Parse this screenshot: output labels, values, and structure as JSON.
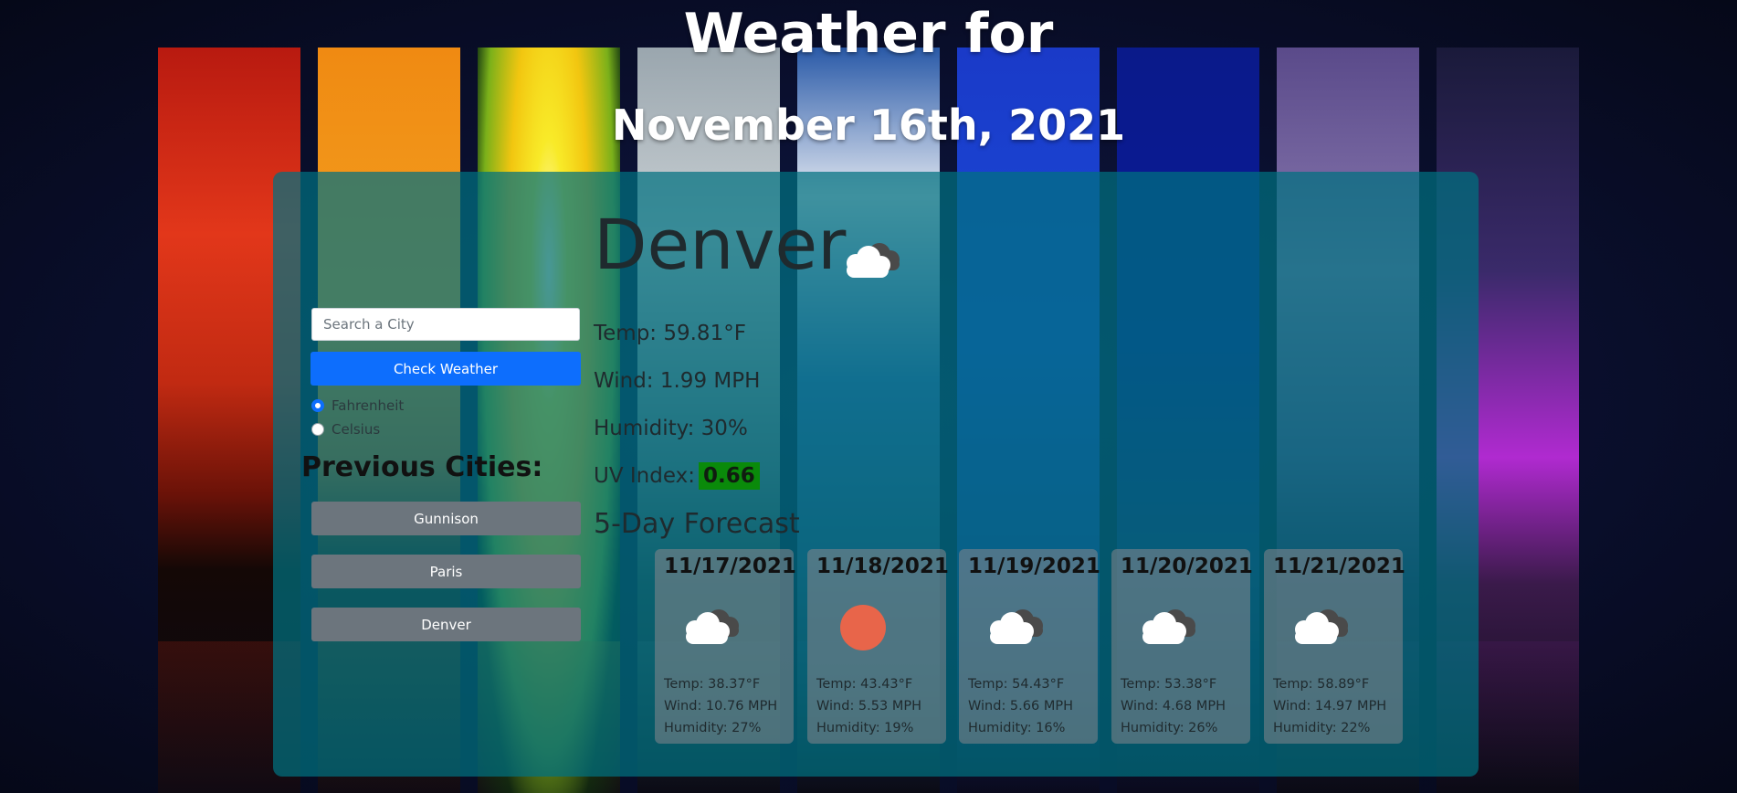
{
  "header": {
    "title_line1": "Weather for",
    "title_line2": "November 16th, 2021"
  },
  "search": {
    "placeholder": "Search a City",
    "value": "",
    "button_label": "Check Weather"
  },
  "units": {
    "options": [
      {
        "label": "Fahrenheit",
        "checked": true
      },
      {
        "label": "Celsius",
        "checked": false
      }
    ]
  },
  "history": {
    "title": "Previous Cities:",
    "cities": [
      "Gunnison",
      "Paris",
      "Denver"
    ]
  },
  "current": {
    "city": "Denver",
    "icon": "cloud-icon",
    "temp": "Temp: 59.81°F",
    "wind": "Wind: 1.99 MPH",
    "humidity": "Humidity: 30%",
    "uv_label": "UV Index:",
    "uv_value": "0.66",
    "uv_color": "#0a8a0a"
  },
  "forecast": {
    "title": "5-Day Forecast",
    "days": [
      {
        "date": "11/17/2021",
        "icon": "cloud-icon",
        "temp": "Temp: 38.37°F",
        "wind": "Wind: 10.76 MPH",
        "humidity": "Humidity: 27%"
      },
      {
        "date": "11/18/2021",
        "icon": "sun-icon",
        "temp": "Temp: 43.43°F",
        "wind": "Wind: 5.53 MPH",
        "humidity": "Humidity: 19%"
      },
      {
        "date": "11/19/2021",
        "icon": "cloud-icon",
        "temp": "Temp: 54.43°F",
        "wind": "Wind: 5.66 MPH",
        "humidity": "Humidity: 16%"
      },
      {
        "date": "11/20/2021",
        "icon": "cloud-icon",
        "temp": "Temp: 53.38°F",
        "wind": "Wind: 4.68 MPH",
        "humidity": "Humidity: 26%"
      },
      {
        "date": "11/21/2021",
        "icon": "cloud-icon",
        "temp": "Temp: 58.89°F",
        "wind": "Wind: 14.97 MPH",
        "humidity": "Humidity: 22%"
      }
    ]
  },
  "colors": {
    "accent": "#0d6efd",
    "secondary": "#6c757d",
    "panel": "#007080",
    "sun": "#e8654a"
  }
}
